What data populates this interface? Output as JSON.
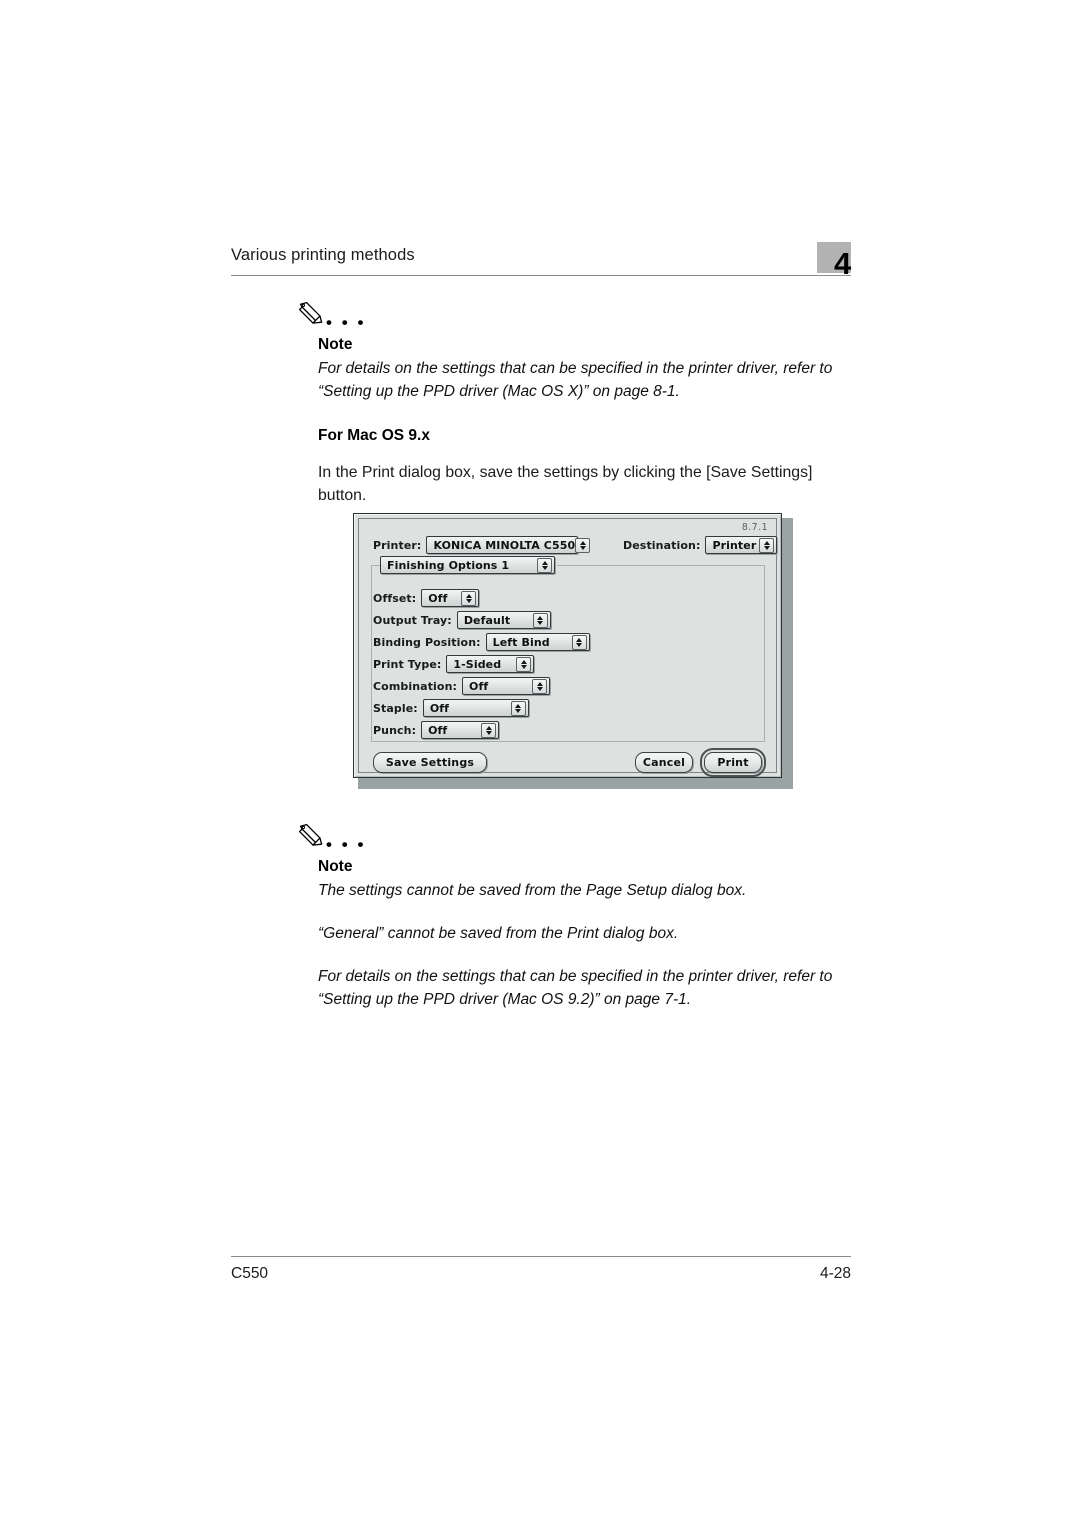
{
  "page": {
    "header_title": "Various printing methods",
    "chapter_number": "4",
    "footer_model": "C550",
    "footer_page": "4-28"
  },
  "note_top": {
    "icon": "pencil-icon",
    "dots": "• • •",
    "label": "Note",
    "paragraphs": [
      "For details on the settings that can be specified in the printer driver, refer to “Setting up the PPD driver (Mac OS X)” on page 8-1."
    ]
  },
  "section": {
    "heading": "For Mac OS 9.x",
    "paragraph": "In the Print dialog box, save the settings by clicking the [Save Settings] button."
  },
  "dialog": {
    "version": "8.7.1",
    "printer_label": "Printer:",
    "printer_value": "KONICA MINOLTA C550",
    "destination_label": "Destination:",
    "destination_value": "Printer",
    "pane_value": "Finishing Options 1",
    "fields": [
      {
        "label": "Offset:",
        "value": "Off"
      },
      {
        "label": "Output Tray:",
        "value": "Default"
      },
      {
        "label": "Binding Position:",
        "value": "Left Bind"
      },
      {
        "label": "Print Type:",
        "value": "1-Sided"
      },
      {
        "label": "Combination:",
        "value": "Off"
      },
      {
        "label": "Staple:",
        "value": "Off"
      },
      {
        "label": "Punch:",
        "value": "Off"
      }
    ],
    "save_settings_button": "Save Settings",
    "cancel_button": "Cancel",
    "print_button": "Print"
  },
  "note_bottom": {
    "icon": "pencil-icon",
    "dots": "• • •",
    "label": "Note",
    "paragraphs": [
      "The settings cannot be saved from the Page Setup dialog box.",
      "“General” cannot be saved from the Print dialog box.",
      "For details on the settings that can be specified in the printer driver, refer to “Setting up the PPD driver (Mac OS 9.2)” on page 7-1."
    ]
  },
  "colors": {
    "dialog_bg": "#dde1e0",
    "chapter_badge": "#b3b3b3",
    "rule": "#8c8c8c"
  }
}
